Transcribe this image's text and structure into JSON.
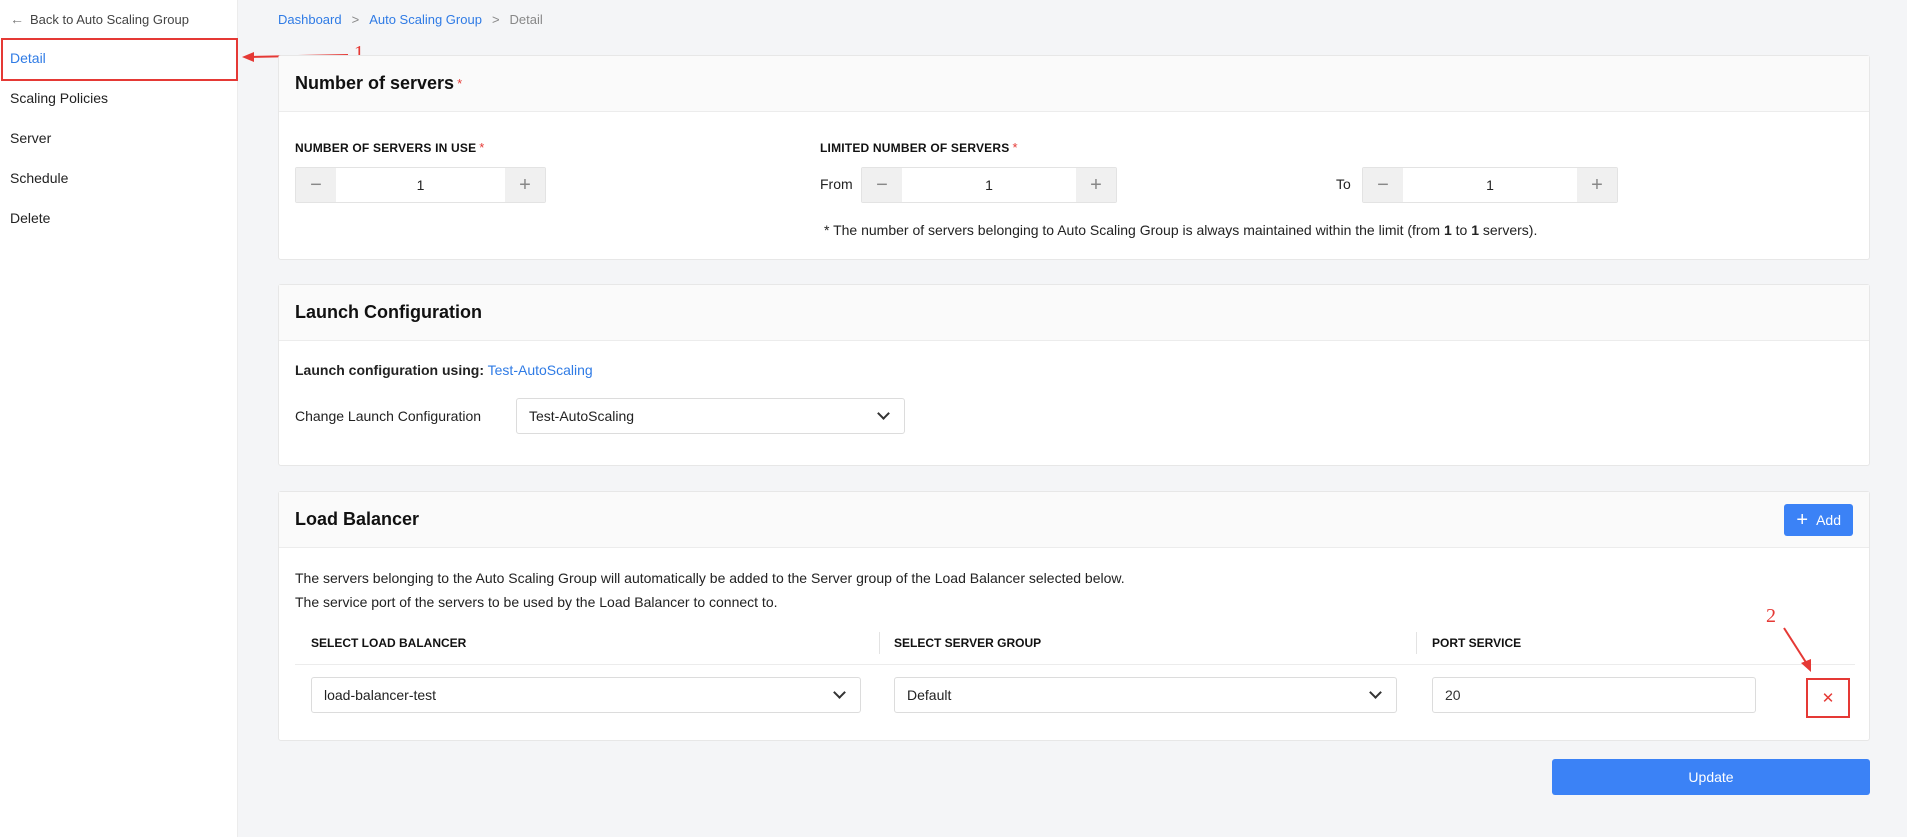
{
  "sidebar": {
    "back_label": "Back to Auto Scaling Group",
    "items": [
      {
        "label": "Detail",
        "active": true
      },
      {
        "label": "Scaling Policies"
      },
      {
        "label": "Server"
      },
      {
        "label": "Schedule"
      },
      {
        "label": "Delete"
      }
    ]
  },
  "breadcrumb": [
    "Dashboard",
    "Auto Scaling Group",
    "Detail"
  ],
  "servers": {
    "title": "Number of servers",
    "in_use_label": "NUMBER OF SERVERS IN USE",
    "in_use_value": "1",
    "limit_label": "LIMITED NUMBER OF SERVERS",
    "from_label": "From",
    "from_value": "1",
    "to_label": "To",
    "to_value": "1",
    "note_prefix": "* The number of servers belonging to Auto Scaling Group is always maintained within the limit (from ",
    "note_from": "1",
    "note_mid": " to ",
    "note_to": "1",
    "note_suffix": " servers)."
  },
  "launch": {
    "title": "Launch Configuration",
    "using_label": "Launch configuration using:",
    "using_value": "Test-AutoScaling",
    "change_label": "Change Launch Configuration",
    "selected": "Test-AutoScaling"
  },
  "lb": {
    "title": "Load Balancer",
    "add_label": "Add",
    "desc1": "The servers belonging to the Auto Scaling Group will automatically be added to the Server group of the Load Balancer selected below.",
    "desc2": "The service port of the servers to be used by the Load Balancer to connect to.",
    "columns": [
      "SELECT LOAD BALANCER",
      "SELECT SERVER GROUP",
      "PORT SERVICE"
    ],
    "row": {
      "load_balancer": "load-balancer-test",
      "server_group": "Default",
      "port": "20"
    }
  },
  "update_label": "Update",
  "annotations": [
    "1",
    "2"
  ],
  "colors": {
    "accent": "#2f7be5",
    "button": "#3b82f6",
    "annotation": "#e53935"
  }
}
